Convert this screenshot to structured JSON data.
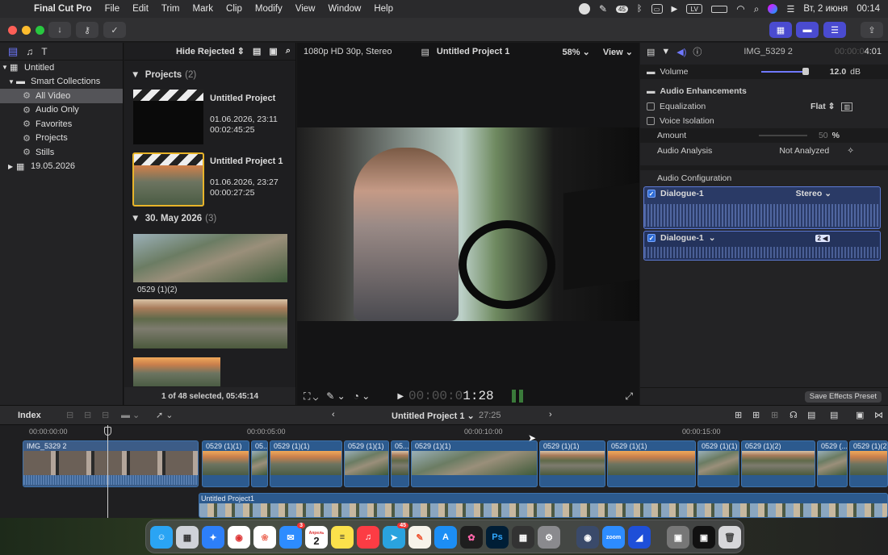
{
  "menubar": {
    "app_name": "Final Cut Pro",
    "items": [
      "File",
      "Edit",
      "Trim",
      "Mark",
      "Clip",
      "Modify",
      "View",
      "Window",
      "Help"
    ],
    "lv": "LV",
    "date": "Вт, 2 июня",
    "time": "00:14",
    "badge": "45"
  },
  "sidebar": {
    "library": "Untitled",
    "smart_collections": "Smart Collections",
    "items": [
      "All Video",
      "Audio Only",
      "Favorites",
      "Projects",
      "Stills"
    ],
    "event": "19.05.2026"
  },
  "browser": {
    "filter": "Hide Rejected",
    "projects_label": "Projects",
    "projects_count": "(2)",
    "project1": {
      "name": "Untitled Project",
      "date": "01.06.2026, 23:11",
      "duration": "00:02:45:25"
    },
    "project2": {
      "name": "Untitled Project 1",
      "date": "01.06.2026, 23:27",
      "duration": "00:00:27:25"
    },
    "event_label": "30. May 2026",
    "event_count": "(3)",
    "clip_label": "0529 (1)(2)",
    "status": "1 of 48 selected, 05:45:14"
  },
  "viewer": {
    "format": "1080p HD 30p, Stereo",
    "project": "Untitled Project 1",
    "zoom": "58%",
    "view": "View",
    "timecode_dim": "00:00:0",
    "timecode": "1:28"
  },
  "inspector": {
    "clip_name": "IMG_5329 2",
    "clip_time_dim": "00:00:0",
    "clip_time": "4:01",
    "volume_label": "Volume",
    "volume_value": "12.0",
    "volume_unit": "dB",
    "audio_enh": "Audio Enhancements",
    "eq_label": "Equalization",
    "eq_value": "Flat",
    "voice_iso": "Voice Isolation",
    "amount_label": "Amount",
    "amount_value": "50",
    "amount_unit": "%",
    "analysis_label": "Audio Analysis",
    "analysis_value": "Not Analyzed",
    "config_label": "Audio Configuration",
    "track1": "Dialogue-1",
    "track1_mode": "Stereo",
    "track2": "Dialogue-1",
    "track2_badge": "2",
    "save_preset": "Save Effects Preset"
  },
  "timeline": {
    "index": "Index",
    "project": "Untitled Project 1",
    "duration": "27:25",
    "ruler": [
      "00:00:00:00",
      "00:00:05:00",
      "00:00:10:00",
      "00:00:15:00"
    ],
    "main_clip": "IMG_5329 2",
    "clips": [
      "0529 (1)(1)",
      "05...",
      "0529 (1)(1)",
      "0529 (1)(1)",
      "05...",
      "0529 (1)(1)",
      "0529 (1)(1)",
      "0529 (1)(1)",
      "0529 (1)(1)",
      "0529 (1)(2)",
      "0529 (...",
      "0529 (1)(2)"
    ],
    "secondary": "Untitled Project1"
  },
  "dock": {
    "calendar_month": "Апрель",
    "calendar_day": "2",
    "mail_badge": "3",
    "telegram_badge": "45",
    "ps": "Ps",
    "zoom": "zoom"
  }
}
